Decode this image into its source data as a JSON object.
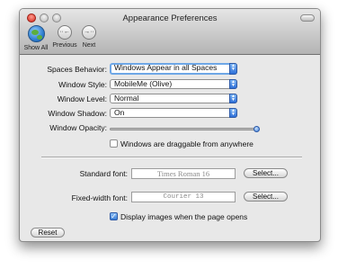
{
  "window": {
    "title": "Appearance Preferences"
  },
  "toolbar": {
    "show_all": "Show All",
    "previous": "Previous",
    "next": "Next",
    "previous_glyph": "··←",
    "next_glyph": "→··"
  },
  "settings": {
    "spaces_behavior": {
      "label": "Spaces Behavior:",
      "value": "Windows Appear in all Spaces"
    },
    "window_style": {
      "label": "Window Style:",
      "value": "MobileMe (Olive)"
    },
    "window_level": {
      "label": "Window Level:",
      "value": "Normal"
    },
    "window_shadow": {
      "label": "Window Shadow:",
      "value": "On"
    },
    "window_opacity": {
      "label": "Window Opacity:",
      "value_fraction": 1.0
    },
    "draggable": {
      "label": "Windows are draggable from anywhere",
      "checked": false
    }
  },
  "fonts": {
    "standard": {
      "label": "Standard font:",
      "value": "Times Roman 16",
      "button": "Select..."
    },
    "fixed_width": {
      "label": "Fixed-width font:",
      "value": "Courier 13",
      "button": "Select..."
    },
    "display_images": {
      "label": "Display images when the page opens",
      "checked": true
    }
  },
  "reset_button": "Reset",
  "icons": {
    "close": "close-icon",
    "minimize": "minimize-icon",
    "zoom": "zoom-icon",
    "show_all": "globe-icon",
    "previous": "back-arrow-icon",
    "next": "forward-arrow-icon",
    "select_arrows": "up-down-arrows-icon",
    "checkmark": "checkmark-icon"
  },
  "colors": {
    "accent": "#3c7fd6",
    "window_bg": "#e8e8e8",
    "close_button": "#d2261a"
  }
}
